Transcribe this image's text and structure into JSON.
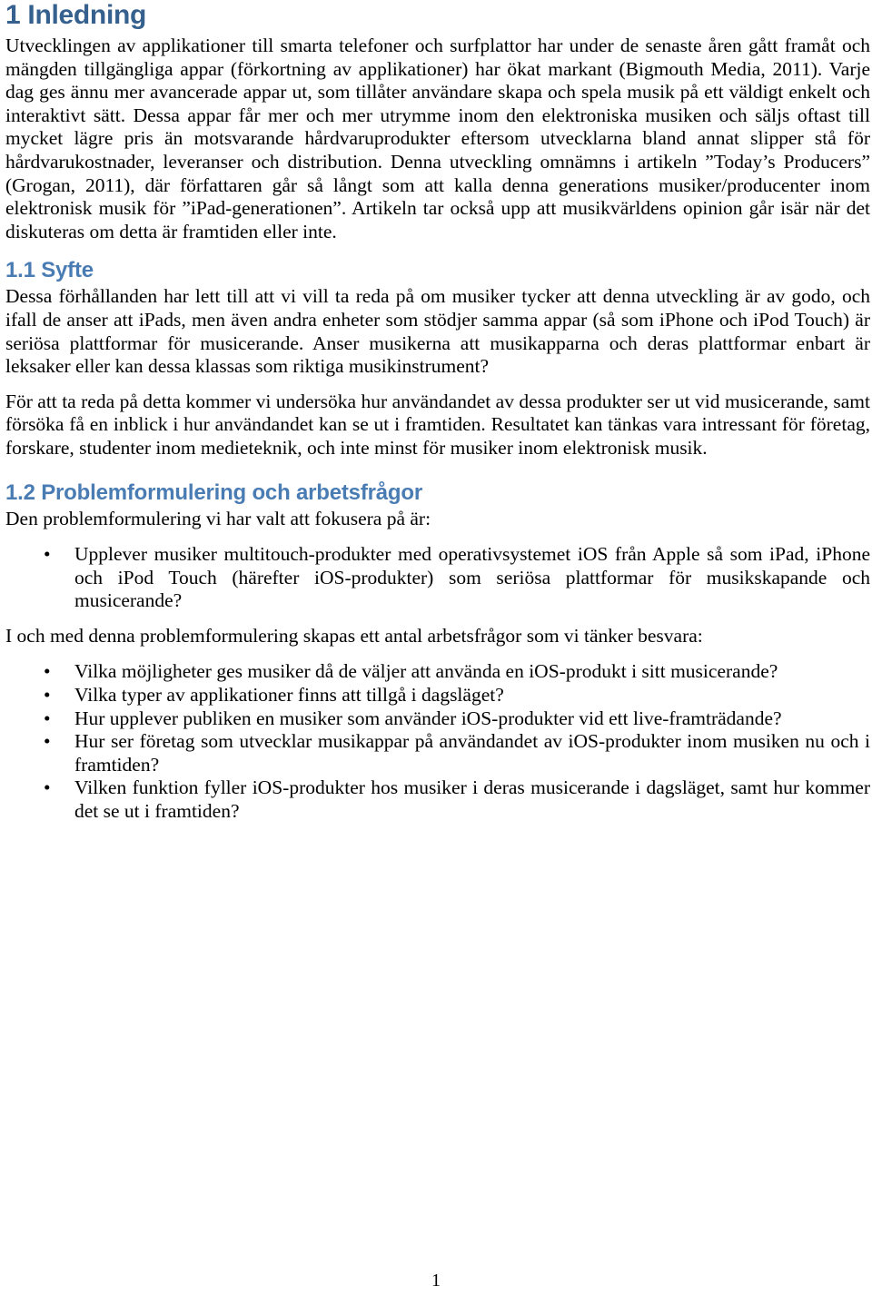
{
  "document": {
    "page_number": "1",
    "heading_color_h1": "#36608d",
    "heading_color_h2": "#4a7cb4",
    "body_color": "#000000"
  },
  "sections": {
    "intro": {
      "heading": "1 Inledning",
      "paragraph_1": "Utvecklingen av applikationer till smarta telefoner och surfplattor har under de senaste åren gått framåt och mängden tillgängliga appar (förkortning av applikationer) har ökat markant (Bigmouth Media, 2011). Varje dag ges ännu mer avancerade appar ut, som tillåter användare skapa och spela musik på ett väldigt enkelt och interaktivt sätt. Dessa appar får mer och mer utrymme inom den elektroniska musiken och säljs oftast till mycket lägre pris än motsvarande hårdvaruprodukter eftersom utvecklarna bland annat slipper stå för hårdvarukostnader, leveranser och distribution. Denna utveckling omnämns i artikeln ”Today’s Producers” (Grogan, 2011), där författaren går så långt som att kalla denna generations musiker/producenter inom elektronisk musik för ”iPad-generationen”. Artikeln tar också upp att musikvärldens opinion går isär när det diskuteras om detta är framtiden eller inte."
    },
    "syfte": {
      "heading": "1.1 Syfte",
      "paragraph_1": "Dessa förhållanden har lett till att vi vill ta reda på om musiker tycker att denna utveckling är av godo, och ifall de anser att iPads, men även andra enheter som stödjer samma appar (så som iPhone och iPod Touch) är seriösa plattformar för musicerande. Anser musikerna att musikapparna och deras plattformar enbart är leksaker eller kan dessa klassas som riktiga musikinstrument?",
      "paragraph_2": "För att ta reda på detta kommer vi undersöka hur användandet av dessa produkter ser ut vid musicerande, samt försöka få en inblick i hur användandet kan se ut i framtiden. Resultatet kan tänkas vara intressant för företag, forskare, studenter inom medieteknik, och inte minst för musiker inom elektronisk musik."
    },
    "problemformulering": {
      "heading": "1.2 Problemformulering och arbetsfrågor",
      "intro_paragraph": "Den problemformulering vi har valt att fokusera på är:",
      "problem_bullets": [
        "Upplever musiker multitouch-produkter med operativsystemet iOS från Apple så som iPad, iPhone och iPod Touch (härefter iOS-produkter) som seriösa plattformar för musikskapande och musicerande?"
      ],
      "questions_lead": "I och med denna problemformulering skapas ett antal arbetsfrågor som vi tänker besvara:",
      "question_bullets": [
        "Vilka möjligheter ges musiker då de väljer att använda en iOS-produkt i sitt musicerande?",
        "Vilka typer av applikationer finns att tillgå i dagsläget?",
        "Hur upplever publiken en musiker som använder iOS-produkter vid ett live-framträdande?",
        "Hur ser företag som utvecklar musikappar på användandet av iOS-produkter inom musiken nu och i framtiden?",
        "Vilken funktion fyller iOS-produkter hos musiker i deras musicerande i dagsläget, samt hur kommer det se ut i framtiden?"
      ]
    }
  },
  "bullet_glyph": "•"
}
